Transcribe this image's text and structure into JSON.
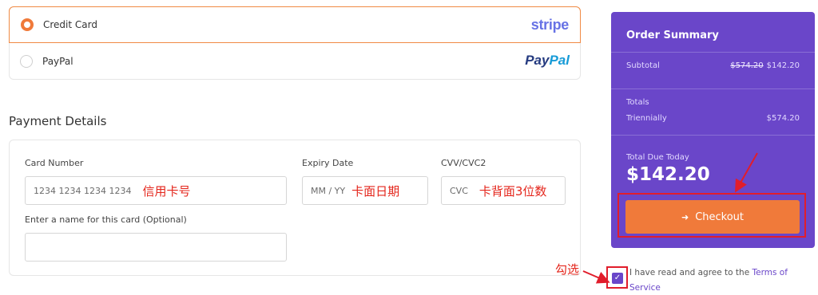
{
  "payment_methods": [
    {
      "label": "Credit Card",
      "selected": true,
      "brand": "stripe"
    },
    {
      "label": "PayPal",
      "selected": false,
      "brand_parts": [
        "Pay",
        "Pal"
      ]
    }
  ],
  "payment_details": {
    "title": "Payment Details",
    "card_number": {
      "label": "Card Number",
      "placeholder": "1234 1234 1234 1234",
      "note": "信用卡号"
    },
    "expiry": {
      "label": "Expiry Date",
      "placeholder": "MM / YY",
      "note": "卡面日期"
    },
    "cvc": {
      "label": "CVV/CVC2",
      "placeholder": "CVC",
      "note": "卡背面3位数"
    },
    "card_name": {
      "label": "Enter a name for this card (Optional)",
      "value": ""
    }
  },
  "order_summary": {
    "title": "Order Summary",
    "subtotal_label": "Subtotal",
    "subtotal_original": "$574.20",
    "subtotal_discounted": "$142.20",
    "totals_label": "Totals",
    "cycle_label": "Triennially",
    "cycle_amount": "$574.20",
    "due_label": "Total Due Today",
    "due_amount": "$142.20",
    "checkout_label": "Checkout"
  },
  "agreement": {
    "checked": true,
    "text": "I have read and agree to the ",
    "link": "Terms of Service",
    "note": "勾选"
  },
  "colors": {
    "accent_orange": "#f07a3a",
    "summary_purple": "#6a46c9",
    "annotation_red": "#e11d2b"
  }
}
